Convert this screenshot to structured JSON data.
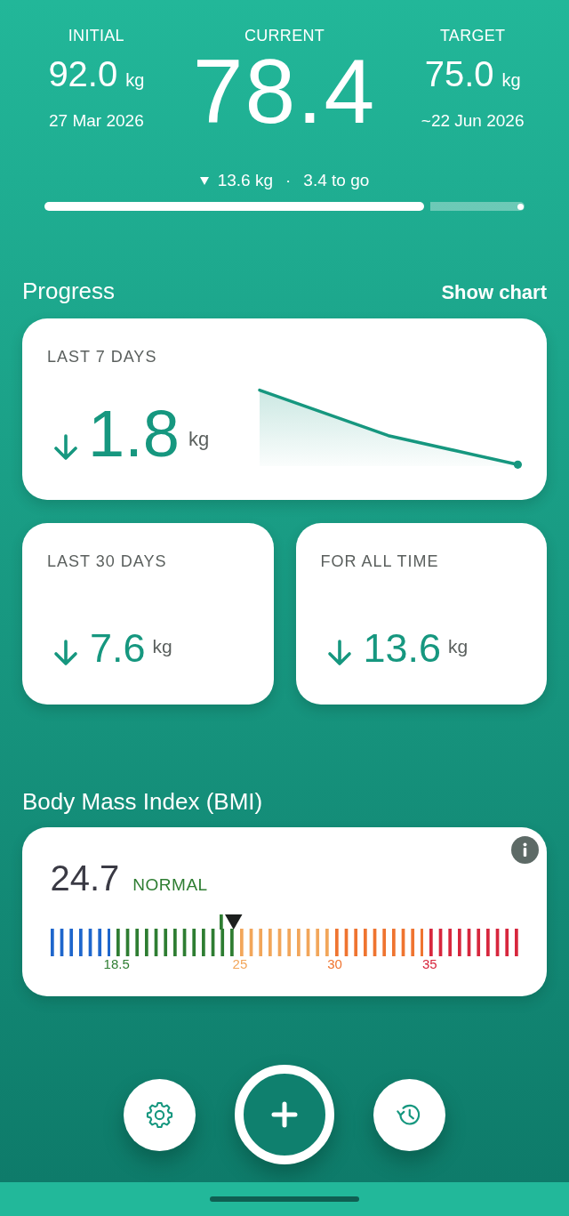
{
  "header": {
    "stats": [
      {
        "kind": "side",
        "label": "INITIAL",
        "value": "92.0",
        "unit": "kg",
        "date": "27 Mar 2026"
      },
      {
        "kind": "main",
        "label": "CURRENT",
        "value": "78.4"
      },
      {
        "kind": "side",
        "label": "TARGET",
        "value": "75.0",
        "unit": "kg",
        "date": "~22 Jun 2026"
      }
    ],
    "summary": {
      "change": "13.6 kg",
      "separator": "·",
      "remaining": "3.4 to go"
    },
    "goal_progress": {
      "level": 0.79
    }
  },
  "progress": {
    "title": "Progress",
    "action": "Show chart",
    "cards": [
      {
        "kind": "wide",
        "label": "LAST 7 DAYS",
        "value": "1.8",
        "unit": "kg"
      },
      {
        "kind": "half",
        "label": "LAST 30 DAYS",
        "value": "7.6",
        "unit": "kg"
      },
      {
        "kind": "half",
        "label": "FOR ALL TIME",
        "value": "13.6",
        "unit": "kg"
      }
    ]
  },
  "bmi": {
    "title": "Body Mass Index (BMI)",
    "value": "24.7",
    "category": "NORMAL",
    "scale": {
      "level": 0.388,
      "segments": [
        {
          "color": "#1e66cc"
        },
        {
          "color": "#2e7d32",
          "label": "18.5"
        },
        {
          "color": "#f2a65a",
          "label": "25"
        },
        {
          "color": "#ef7430",
          "label": "30"
        },
        {
          "color": "#d7263d",
          "label": "35"
        }
      ]
    }
  }
}
